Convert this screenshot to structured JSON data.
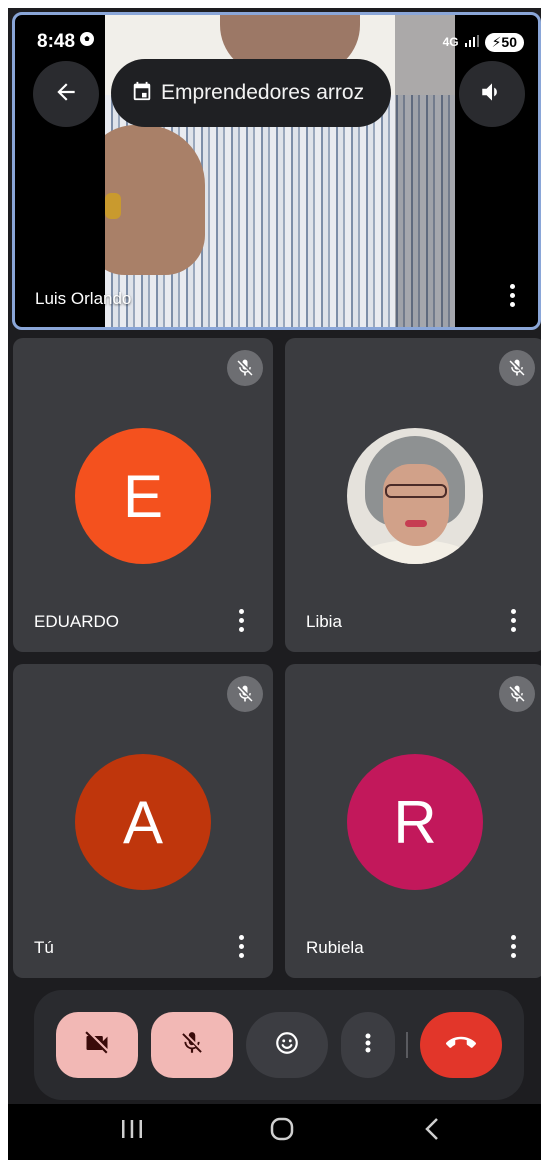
{
  "status_bar": {
    "time": "8:48",
    "network": "4G",
    "battery": "50"
  },
  "header": {
    "meeting_title": "Emprendedores arroz"
  },
  "featured": {
    "name": "Luis Orlando"
  },
  "participants": [
    {
      "name": "EDUARDO",
      "initial": "E",
      "avatar_color": "#f4511e",
      "muted": true
    },
    {
      "name": "Libia",
      "initial": "",
      "avatar_color": "#e5e2dc",
      "muted": true,
      "photo": true
    },
    {
      "name": "Tú",
      "initial": "A",
      "avatar_color": "#bf360c",
      "muted": true
    },
    {
      "name": "Rubiela",
      "initial": "R",
      "avatar_color": "#c2185b",
      "muted": true
    }
  ],
  "colors": {
    "background": "#1d1d20",
    "tile": "#3b3c40",
    "featured_border": "#8aa6d8",
    "off_control": "#f2b8b5",
    "hangup": "#e2362a"
  },
  "icons": {
    "back": "arrow-left-icon",
    "calendar": "calendar-icon",
    "speaker": "speaker-icon",
    "mic_muted": "mic-off-icon",
    "camera_off": "camera-off-icon",
    "emoji": "emoji-icon",
    "more": "more-vert-icon",
    "hangup": "phone-hangup-icon"
  }
}
